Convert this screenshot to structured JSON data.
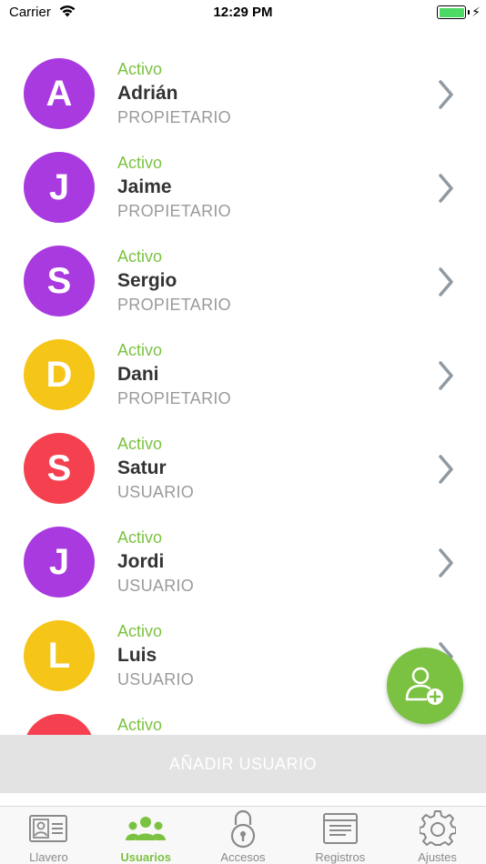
{
  "status_bar": {
    "carrier": "Carrier",
    "time": "12:29 PM",
    "battery_level": 1.0
  },
  "colors": {
    "accent": "#7cc242",
    "purple": "#a93ae0",
    "yellow": "#f5c518",
    "red": "#f5414f"
  },
  "users": [
    {
      "initial": "A",
      "status": "Activo",
      "name": "Adrián",
      "role": "PROPIETARIO",
      "color": "#a93ae0"
    },
    {
      "initial": "J",
      "status": "Activo",
      "name": "Jaime",
      "role": "PROPIETARIO",
      "color": "#a93ae0"
    },
    {
      "initial": "S",
      "status": "Activo",
      "name": "Sergio",
      "role": "PROPIETARIO",
      "color": "#a93ae0"
    },
    {
      "initial": "D",
      "status": "Activo",
      "name": "Dani",
      "role": "PROPIETARIO",
      "color": "#f5c518"
    },
    {
      "initial": "S",
      "status": "Activo",
      "name": "Satur",
      "role": "USUARIO",
      "color": "#f5414f"
    },
    {
      "initial": "J",
      "status": "Activo",
      "name": "Jordi",
      "role": "USUARIO",
      "color": "#a93ae0"
    },
    {
      "initial": "L",
      "status": "Activo",
      "name": "Luis",
      "role": "USUARIO",
      "color": "#f5c518"
    },
    {
      "initial": "",
      "status": "Activo",
      "name": "",
      "role": "",
      "color": "#f5414f"
    }
  ],
  "add_button": {
    "label": "AÑADIR USUARIO"
  },
  "tabs": [
    {
      "label": "Llavero",
      "icon": "id-card-icon",
      "active": false
    },
    {
      "label": "Usuarios",
      "icon": "users-group-icon",
      "active": true
    },
    {
      "label": "Accesos",
      "icon": "padlock-icon",
      "active": false
    },
    {
      "label": "Registros",
      "icon": "register-list-icon",
      "active": false
    },
    {
      "label": "Ajustes",
      "icon": "gear-icon",
      "active": false
    }
  ]
}
